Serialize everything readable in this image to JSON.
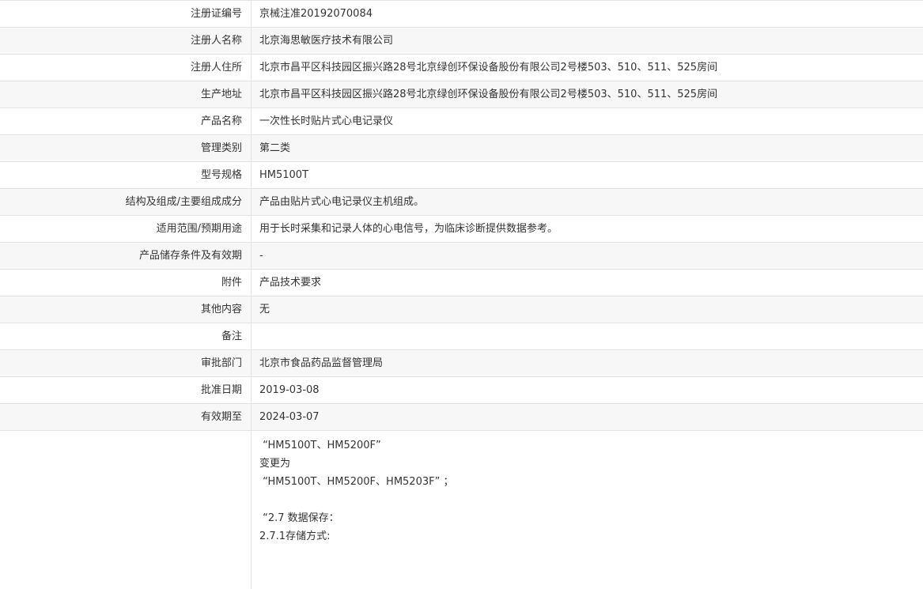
{
  "rows": [
    {
      "label": "注册证编号",
      "value": "京械注准20192070084"
    },
    {
      "label": "注册人名称",
      "value": "北京海思敏医疗技术有限公司"
    },
    {
      "label": "注册人住所",
      "value": "北京市昌平区科技园区振兴路28号北京绿创环保设备股份有限公司2号楼503、510、511、525房间"
    },
    {
      "label": "生产地址",
      "value": "北京市昌平区科技园区振兴路28号北京绿创环保设备股份有限公司2号楼503、510、511、525房间"
    },
    {
      "label": "产品名称",
      "value": "一次性长时贴片式心电记录仪"
    },
    {
      "label": "管理类别",
      "value": "第二类"
    },
    {
      "label": "型号规格",
      "value": "HM5100T"
    },
    {
      "label": "结构及组成/主要组成成分",
      "value": "产品由贴片式心电记录仪主机组成。"
    },
    {
      "label": "适用范围/预期用途",
      "value": "用于长时采集和记录人体的心电信号，为临床诊断提供数据参考。"
    },
    {
      "label": "产品储存条件及有效期",
      "value": "-"
    },
    {
      "label": "附件",
      "value": "产品技术要求"
    },
    {
      "label": "其他内容",
      "value": "无"
    },
    {
      "label": "备注",
      "value": ""
    },
    {
      "label": "审批部门",
      "value": "北京市食品药品监督管理局"
    },
    {
      "label": "批准日期",
      "value": "2019-03-08"
    },
    {
      "label": "有效期至",
      "value": "2024-03-07"
    }
  ],
  "change_content": [
    " “HM5100T、HM5200F”",
    "变更为",
    " “HM5100T、HM5200F、HM5203F” ；",
    "",
    " “2.7 数据保存：",
    "2.7.1存储方式:"
  ]
}
